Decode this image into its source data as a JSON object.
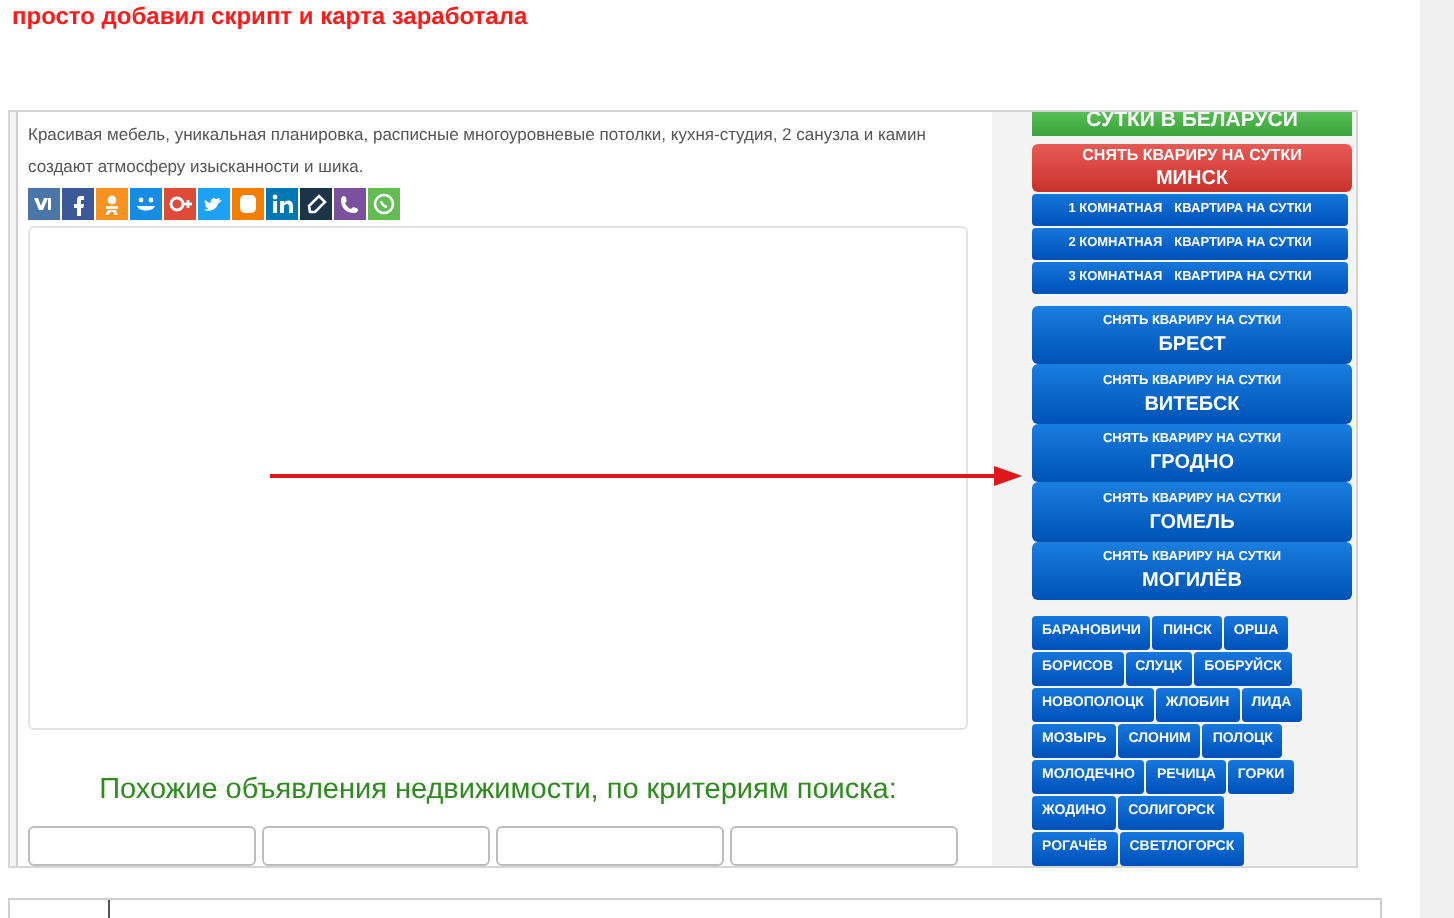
{
  "heading": "просто добавил скрипт и карта заработала",
  "description": "Красивая мебель, уникальная планировка, расписные многоуровневые потолки, кухня-студия, 2 санузла и камин создают атмосферу изысканности и шика.",
  "share_buttons": [
    {
      "color": "#4a76a8"
    },
    {
      "color": "#3b5998"
    },
    {
      "color": "#f7931e"
    },
    {
      "color": "#168de2"
    },
    {
      "color": "#dd4b39"
    },
    {
      "color": "#1da1f2"
    },
    {
      "color": "#f57d00"
    },
    {
      "color": "#0077b5"
    },
    {
      "color": "#1c3448"
    },
    {
      "color": "#7b519d"
    },
    {
      "color": "#65bc54"
    }
  ],
  "similar_title": "Похожие объявления недвижимости, по критериям поиска:",
  "sidebar": {
    "country_button": {
      "line2": "СУТКИ В БЕЛАРУСИ"
    },
    "capital_button": {
      "line1": "СНЯТЬ КВАРИРУ НА СУТКИ",
      "line2": "МИНСК"
    },
    "room_links": [
      {
        "rooms": "1 КОМНАТНАЯ",
        "label": "КВАРТИРА НА СУТКИ"
      },
      {
        "rooms": "2 КОМНАТНАЯ",
        "label": "КВАРТИРА НА СУТКИ"
      },
      {
        "rooms": "3 КОМНАТНАЯ",
        "label": "КВАРТИРА НА СУТКИ"
      }
    ],
    "region_buttons": [
      {
        "line1": "СНЯТЬ КВАРИРУ НА СУТКИ",
        "line2": "БРЕСТ"
      },
      {
        "line1": "СНЯТЬ КВАРИРУ НА СУТКИ",
        "line2": "ВИТЕБСК"
      },
      {
        "line1": "СНЯТЬ КВАРИРУ НА СУТКИ",
        "line2": "ГРОДНО"
      },
      {
        "line1": "СНЯТЬ КВАРИРУ НА СУТКИ",
        "line2": "ГОМЕЛЬ"
      },
      {
        "line1": "СНЯТЬ КВАРИРУ НА СУТКИ",
        "line2": "МОГИЛЁВ"
      }
    ],
    "city_rows": [
      [
        "БАРАНОВИЧИ",
        "ПИНСК",
        "ОРША"
      ],
      [
        "БОРИСОВ",
        "СЛУЦК",
        "БОБРУЙСК"
      ],
      [
        "НОВОПОЛОЦК",
        "ЖЛОБИН",
        "ЛИДА"
      ],
      [
        "МОЗЫРЬ",
        "СЛОНИМ",
        "ПОЛОЦК"
      ],
      [
        "МОЛОДЕЧНО",
        "РЕЧИЦА",
        "ГОРКИ"
      ],
      [
        "ЖОДИНО",
        "СОЛИГОРСК"
      ],
      [
        "РОГАЧЁВ",
        "СВЕТЛОГОРСК"
      ]
    ]
  }
}
